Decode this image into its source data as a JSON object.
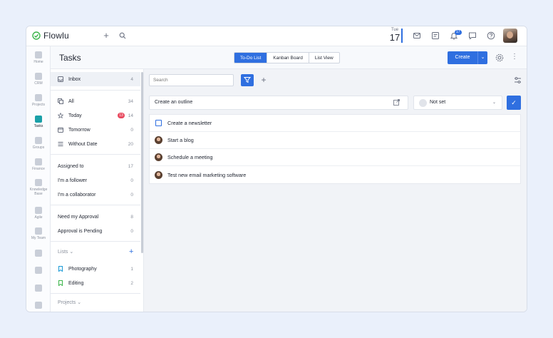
{
  "app": {
    "name": "Flowlu"
  },
  "topbar": {
    "date": {
      "weekday": "Tue",
      "day": "17"
    },
    "notifications_count": "17"
  },
  "rail": [
    {
      "label": "Home",
      "icon": "home-icon"
    },
    {
      "label": "CRM",
      "icon": "crm-icon"
    },
    {
      "label": "Projects",
      "icon": "projects-icon"
    },
    {
      "label": "Tasks",
      "icon": "tasks-icon",
      "active": true
    },
    {
      "label": "Groups",
      "icon": "groups-icon"
    },
    {
      "label": "Finance",
      "icon": "finance-icon"
    },
    {
      "label": "Knowledge",
      "label2": "Base",
      "icon": "knowledge-base-icon"
    },
    {
      "label": "Agile",
      "icon": "agile-icon"
    },
    {
      "label": "My Team",
      "icon": "team-icon"
    }
  ],
  "header": {
    "title": "Tasks",
    "tabs": [
      "To-Do List",
      "Kanban Board",
      "List View"
    ],
    "active_tab": "To-Do List",
    "create_label": "Create"
  },
  "filters": {
    "inbox": {
      "label": "Inbox",
      "count": "4"
    },
    "all": {
      "label": "All",
      "count": "34"
    },
    "today": {
      "label": "Today",
      "badge": "13",
      "count": "14"
    },
    "tomorrow": {
      "label": "Tomorrow",
      "count": "0"
    },
    "without_date": {
      "label": "Without Date",
      "count": "20"
    },
    "assigned_to": {
      "label": "Assigned to",
      "count": "17"
    },
    "follower": {
      "label": "I'm a follower",
      "count": "0"
    },
    "collaborator": {
      "label": "I'm a collaborator",
      "count": "0"
    },
    "need_approval": {
      "label": "Need my Approval",
      "count": "8"
    },
    "approval_pending": {
      "label": "Approval is Pending",
      "count": "0"
    },
    "lists_heading": "Lists",
    "lists": [
      {
        "label": "Photography",
        "count": "1",
        "color": "#1a9ad6"
      },
      {
        "label": "Editing",
        "count": "2",
        "color": "#3bb54a"
      }
    ],
    "projects_heading": "Projects"
  },
  "main": {
    "search_placeholder": "Search",
    "outline_label": "Create an outline",
    "status_label": "Not set",
    "tasks": [
      {
        "title": "Create a newsletter",
        "marker": "checkbox"
      },
      {
        "title": "Start a blog",
        "marker": "avatar"
      },
      {
        "title": "Schedule a meeting",
        "marker": "avatar"
      },
      {
        "title": "Test new email marketing software",
        "marker": "avatar"
      }
    ]
  },
  "colors": {
    "accent": "#2f6fe0",
    "badge_red": "#e84a5f",
    "tasks_teal": "#1aa0a8"
  }
}
